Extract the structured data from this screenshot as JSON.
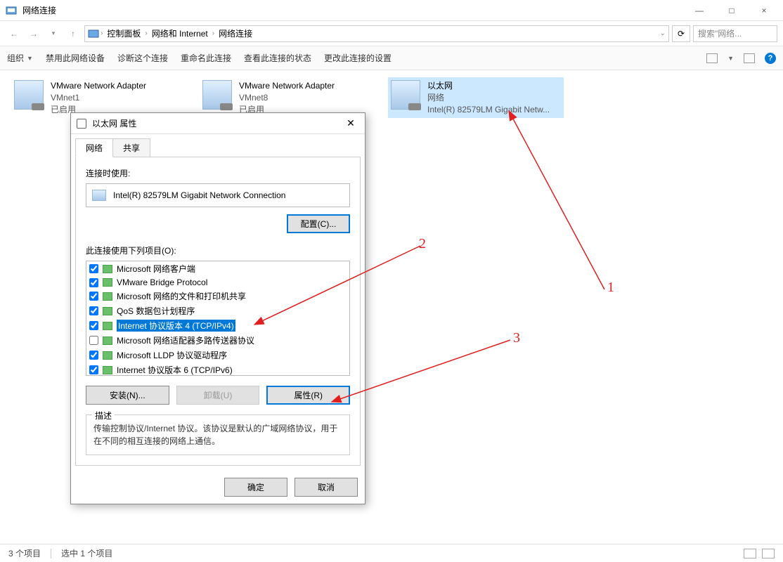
{
  "window": {
    "title": "网络连接",
    "minimize": "—",
    "maximize": "□",
    "close": "×"
  },
  "nav": {
    "breadcrumb": [
      "控制面板",
      "网络和 Internet",
      "网络连接"
    ],
    "search_placeholder": "搜索\"网络..."
  },
  "toolbar": {
    "organize": "组织",
    "disable": "禁用此网络设备",
    "diagnose": "诊断这个连接",
    "rename": "重命名此连接",
    "status": "查看此连接的状态",
    "change": "更改此连接的设置"
  },
  "adapters": [
    {
      "name": "VMware Network Adapter",
      "line2": "VMnet1",
      "line3": "已启用"
    },
    {
      "name": "VMware Network Adapter",
      "line2": "VMnet8",
      "line3": "已启用"
    },
    {
      "name": "以太网",
      "line2": "网络",
      "line3": "Intel(R) 82579LM Gigabit Netw..."
    }
  ],
  "dialog": {
    "title": "以太网 属性",
    "tabs": {
      "network": "网络",
      "share": "共享"
    },
    "connect_using_label": "连接时使用:",
    "adapter_name": "Intel(R) 82579LM Gigabit Network Connection",
    "configure_btn": "配置(C)...",
    "items_label": "此连接使用下列项目(O):",
    "components": [
      {
        "checked": true,
        "label": "Microsoft 网络客户端"
      },
      {
        "checked": true,
        "label": "VMware Bridge Protocol"
      },
      {
        "checked": true,
        "label": "Microsoft 网络的文件和打印机共享"
      },
      {
        "checked": true,
        "label": "QoS 数据包计划程序"
      },
      {
        "checked": true,
        "label": "Internet 协议版本 4 (TCP/IPv4)",
        "selected": true
      },
      {
        "checked": false,
        "label": "Microsoft 网络适配器多路传送器协议"
      },
      {
        "checked": true,
        "label": "Microsoft LLDP 协议驱动程序"
      },
      {
        "checked": true,
        "label": "Internet 协议版本 6 (TCP/IPv6)"
      }
    ],
    "install_btn": "安装(N)...",
    "uninstall_btn": "卸载(U)",
    "properties_btn": "属性(R)",
    "desc_legend": "描述",
    "desc_text": "传输控制协议/Internet 协议。该协议是默认的广域网络协议，用于在不同的相互连接的网络上通信。",
    "ok_btn": "确定",
    "cancel_btn": "取消"
  },
  "statusbar": {
    "count": "3 个项目",
    "selected": "选中 1 个项目"
  },
  "annotations": {
    "a1": "1",
    "a2": "2",
    "a3": "3"
  }
}
